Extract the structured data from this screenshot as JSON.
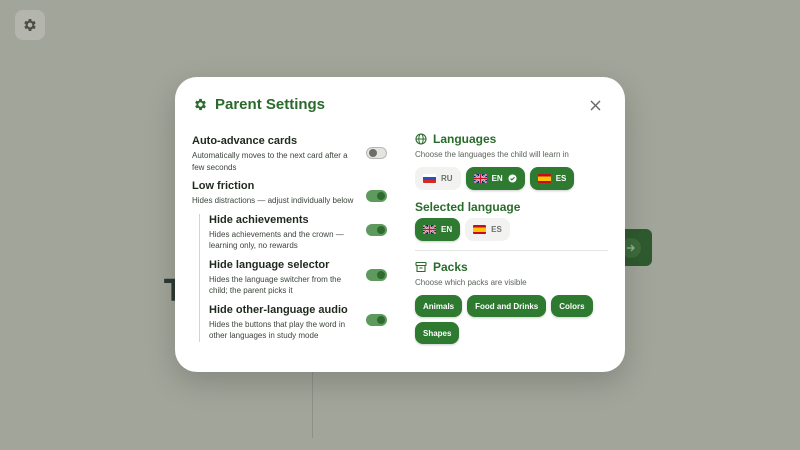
{
  "background": {
    "title_fragment": "T"
  },
  "modal": {
    "title": "Parent Settings",
    "settings": [
      {
        "title": "Auto-advance cards",
        "desc": "Automatically moves to the next card after a few seconds",
        "enabled": false
      },
      {
        "title": "Low friction",
        "desc": "Hides distractions — adjust individually below",
        "enabled": true
      }
    ],
    "sub_settings": [
      {
        "title": "Hide achievements",
        "desc": "Hides achievements and the crown — learning only, no rewards",
        "enabled": true
      },
      {
        "title": "Hide language selector",
        "desc": "Hides the language switcher from the child; the parent picks it",
        "enabled": true
      },
      {
        "title": "Hide other-language audio",
        "desc": "Hides the buttons that play the word in other languages in study mode",
        "enabled": true
      }
    ],
    "languages": {
      "title": "Languages",
      "subtitle": "Choose the languages the child will learn in",
      "options": [
        {
          "code": "RU",
          "selected": false
        },
        {
          "code": "EN",
          "selected": true,
          "primary": true
        },
        {
          "code": "ES",
          "selected": true
        }
      ]
    },
    "selected_language": {
      "title": "Selected language",
      "options": [
        {
          "code": "EN",
          "active": true
        },
        {
          "code": "ES",
          "active": false
        }
      ]
    },
    "packs": {
      "title": "Packs",
      "subtitle": "Choose which packs are visible",
      "items": [
        "Animals",
        "Food and Drinks",
        "Colors",
        "Shapes"
      ]
    }
  },
  "colors": {
    "accent": "#2d7a30",
    "accent_text": "#2a6b2c",
    "overlay": "#a2a59a"
  }
}
